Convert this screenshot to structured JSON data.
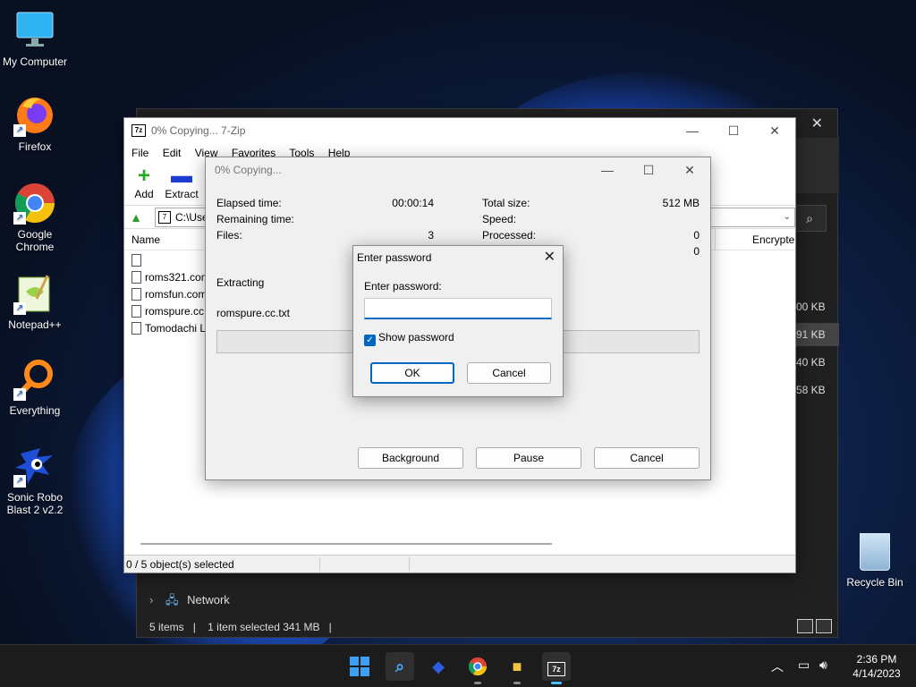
{
  "desktop": {
    "icons": [
      {
        "label": "My Computer"
      },
      {
        "label": "Firefox"
      },
      {
        "label": "Google Chrome"
      },
      {
        "label": "Notepad++"
      },
      {
        "label": "Everything"
      },
      {
        "label": "Sonic Robo Blast 2 v2.2"
      }
    ],
    "recycle_bin": "Recycle Bin"
  },
  "explorer": {
    "sizes": [
      "00 KB",
      "91 KB",
      "40 KB",
      "58 KB"
    ],
    "nav_network": "Network",
    "status": {
      "items": "5 items",
      "selected": "1 item selected  341 MB"
    }
  },
  "zip": {
    "title": "0% Copying... 7-Zip",
    "logo": "7z",
    "menu": [
      "File",
      "Edit",
      "View",
      "Favorites",
      "Tools",
      "Help"
    ],
    "tools": {
      "add": "Add",
      "extract": "Extract"
    },
    "address": "C:\\Use",
    "columns": {
      "name": "Name",
      "encrypted": "Encrypte"
    },
    "rows": [
      "",
      "roms321.com",
      "romsfun.com",
      "romspure.cc",
      "Tomodachi L"
    ],
    "status": "0 / 5 object(s) selected"
  },
  "progress": {
    "title": "0% Copying...",
    "elapsed_label": "Elapsed time:",
    "elapsed_value": "00:00:14",
    "remaining_label": "Remaining time:",
    "files_label": "Files:",
    "files_value": "3",
    "total_label": "Total size:",
    "total_value": "512 MB",
    "speed_label": "Speed:",
    "processed_label": "Processed:",
    "processed_value": "0",
    "extra_value": "0",
    "action": "Extracting",
    "current_file": "romspure.cc.txt",
    "percent": 0,
    "buttons": {
      "background": "Background",
      "pause": "Pause",
      "cancel": "Cancel"
    }
  },
  "password_dialog": {
    "title": "Enter password",
    "label": "Enter password:",
    "value": "",
    "show_password": "Show password",
    "show_password_checked": true,
    "ok": "OK",
    "cancel": "Cancel"
  },
  "taskbar": {
    "time": "2:36 PM",
    "date": "4/14/2023",
    "active_color": "#4cc2ff"
  }
}
